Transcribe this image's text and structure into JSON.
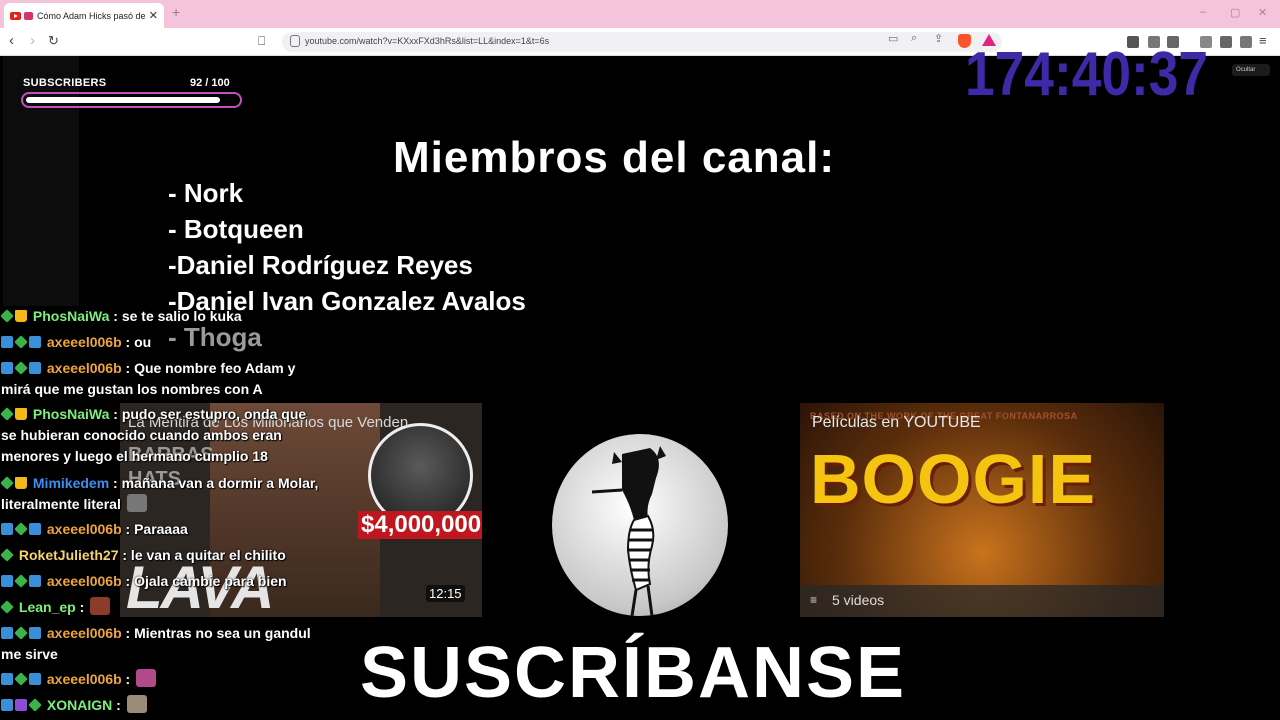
{
  "browser": {
    "tab_title": "Cómo Adam Hicks pasó de E",
    "new_tab_label": "+",
    "url": "youtube.com/watch?v=KXxxFXd3hRs&list=LL&index=1&t=6s",
    "window_controls": [
      "–",
      "▢",
      "✕"
    ]
  },
  "overlay": {
    "subscribers_label": "SUBSCRIBERS",
    "subscribers_count": "92  / 100",
    "subscribers_progress": 0.92,
    "timer": "174:40:37",
    "hide_button": "Ocultar"
  },
  "video": {
    "members_title": "Miembros del canal:",
    "members": [
      "- Nork",
      "- Botqueen",
      "-Daniel Rodríguez Reyes",
      "-Daniel Ivan Gonzalez Avalos",
      "- Thoga"
    ],
    "card1": {
      "title": "La Mentira de Los Millonarios que Venden",
      "words": "BARBAS\nHATS",
      "money": "$4,000,000",
      "big_text": "LAVA DINERO",
      "duration": "12:15"
    },
    "card2": {
      "top_text": "BASED ON THE WORK OF THE GREAT FONTANARROSA",
      "title": "Películas en YOUTUBE",
      "big_text": "BOOGIE",
      "video_count": "5 videos"
    },
    "cta": "SUSCRÍBANSE"
  },
  "chat": [
    {
      "user": "PhosNaiWa",
      "color": "#7cf07a",
      "badges": [
        "green",
        "crown"
      ],
      "text": ": se te salio lo kuka"
    },
    {
      "user": "axeeel006b",
      "color": "#f0a43a",
      "badges": [
        "blue",
        "green",
        "blue"
      ],
      "text": ": ou"
    },
    {
      "user": "axeeel006b",
      "color": "#f0a43a",
      "badges": [
        "blue",
        "green",
        "blue"
      ],
      "text": ": Que nombre feo Adam y mirá que me gustan los nombres con A"
    },
    {
      "user": "PhosNaiWa",
      "color": "#7cf07a",
      "badges": [
        "green",
        "crown"
      ],
      "text": ": pudo ser estupro, onda que se hubieran conocido cuando ambos eran menores y luego el hermano cumplio 18"
    },
    {
      "user": "Mimikedem",
      "color": "#3e8ef0",
      "badges": [
        "green",
        "crown"
      ],
      "text": ": mañana van a dormir a Molar, literalmente literal"
    },
    {
      "user": "axeeel006b",
      "color": "#f0a43a",
      "badges": [
        "blue",
        "green",
        "blue"
      ],
      "text": ": Paraaaa"
    },
    {
      "user": "RoketJulieth27",
      "color": "#f3d36a",
      "badges": [
        "green"
      ],
      "text": ": le van a quitar el chilito"
    },
    {
      "user": "axeeel006b",
      "color": "#f0a43a",
      "badges": [
        "blue",
        "green",
        "blue"
      ],
      "text": ": Ojala cambie para bien"
    },
    {
      "user": "Lean_ep",
      "color": "#7cf07a",
      "badges": [
        "green"
      ],
      "text": ":"
    },
    {
      "user": "axeeel006b",
      "color": "#f0a43a",
      "badges": [
        "blue",
        "green",
        "blue"
      ],
      "text": ": Mientras no sea un gandul me sirve"
    },
    {
      "user": "axeeel006b",
      "color": "#f0a43a",
      "badges": [
        "blue",
        "green",
        "blue"
      ],
      "text": ":"
    },
    {
      "user": "XONAIGN",
      "color": "#7cf07a",
      "badges": [
        "blue",
        "purple",
        "green"
      ],
      "text": ":"
    }
  ]
}
